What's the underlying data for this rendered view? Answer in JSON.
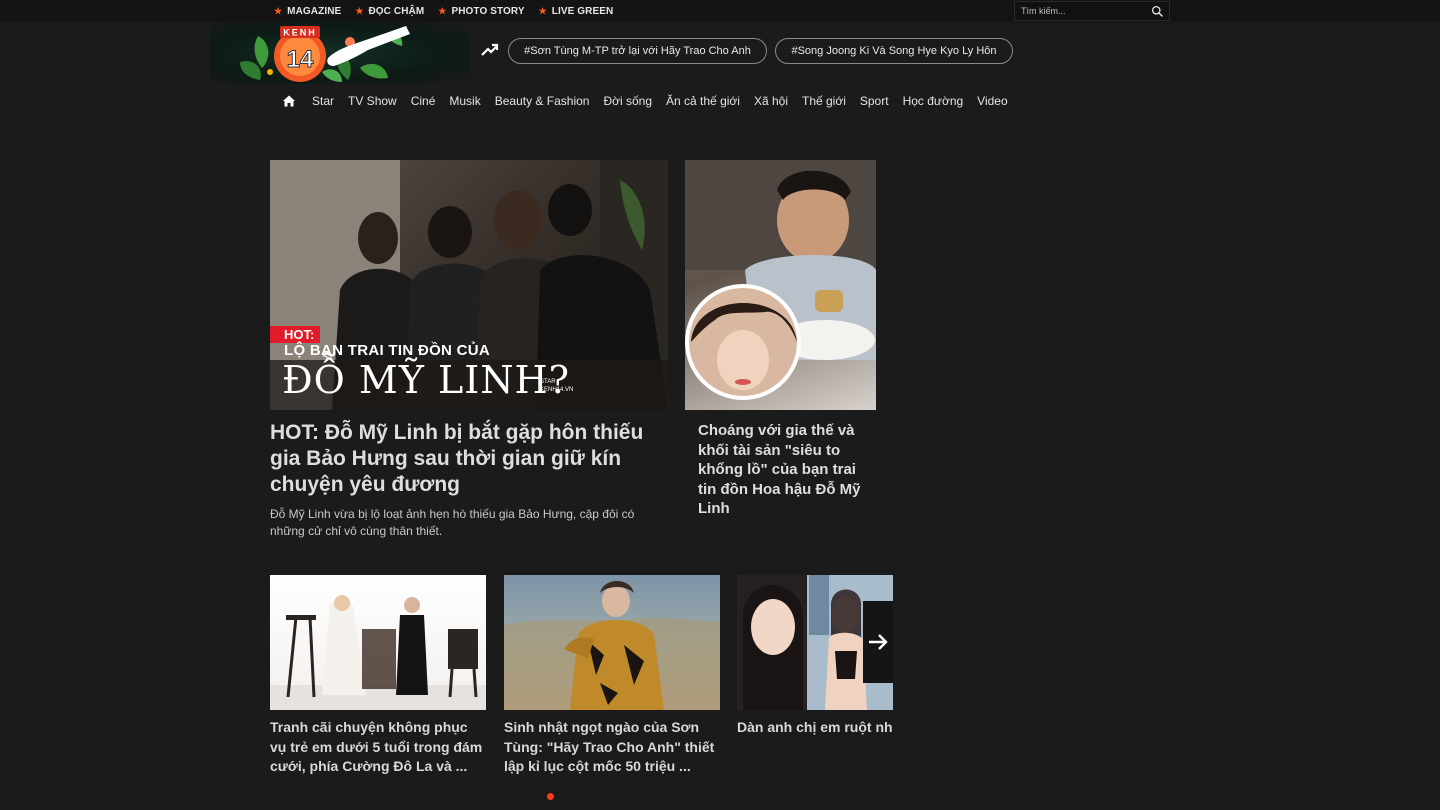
{
  "topbar": {
    "links": [
      "MAGAZINE",
      "ĐỌC CHẬM",
      "PHOTO STORY",
      "LIVE GREEN"
    ],
    "search_placeholder": "Tìm kiếm..."
  },
  "header": {
    "logo_text": "KENH",
    "logo_number": "14",
    "trending_tags": [
      "#Sơn Tùng M-TP trở lại với Hãy Trao Cho Anh",
      "#Song Joong Ki Và Song Hye Kyo Ly Hôn"
    ]
  },
  "nav": {
    "items": [
      "Star",
      "TV Show",
      "Ciné",
      "Musik",
      "Beauty & Fashion",
      "Đời sống",
      "Ăn cả thế giới",
      "Xã hội",
      "Thế giới",
      "Sport",
      "Học đường",
      "Video"
    ]
  },
  "feature": {
    "overlay_badge": "HOT:",
    "overlay_line1": "LỘ BẠN TRAI TIN ĐỒN CỦA",
    "overlay_line2": "ĐỖ MỸ LINH?",
    "overlay_mark1": "STAR",
    "overlay_mark2": "KENH14.VN",
    "title": "HOT: Đỗ Mỹ Linh bị bắt gặp hôn thiếu gia Bảo Hưng sau thời gian giữ kín chuyện yêu đương",
    "sapo": "Đỗ Mỹ Linh vừa bị lộ loạt ảnh hẹn hò thiếu gia Bảo Hưng, cặp đôi có những cử chỉ vô cùng thân thiết."
  },
  "side_story": {
    "title": "Choáng với gia thế và khối tài sản \"siêu to khổng lồ\" của bạn trai tin đồn Hoa hậu Đỗ Mỹ Linh"
  },
  "slider": {
    "cards": [
      "Tranh cãi chuyện không phục vụ trẻ em dưới 5 tuổi trong đám cưới, phía Cường Đô La và ...",
      "Sinh nhật ngọt ngào của Sơn Tùng: \"Hãy Trao Cho Anh\" thiết lập kỉ lục cột mốc 50 triệu ...",
      "Dàn anh chị em ruột nhóm toàn cầu BTS: Chị gái th giàu nhất sexy như idol,"
    ]
  },
  "colors": {
    "accent": "#ff5a1f",
    "background": "#1b1b1b",
    "hot_red": "#e01b2a"
  }
}
